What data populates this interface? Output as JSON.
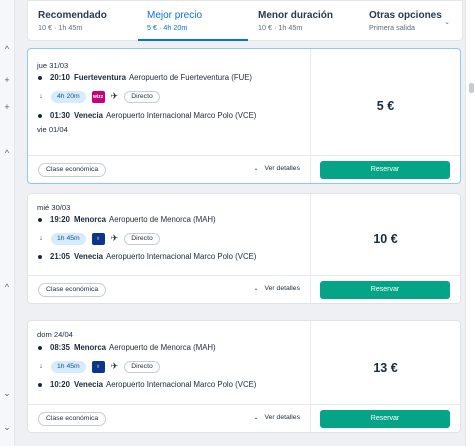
{
  "sort_tabs": [
    {
      "title": "Recomendado",
      "sub": "10 € · 1h 45m"
    },
    {
      "title": "Mejor precio",
      "sub": "5 € · 4h 20m"
    },
    {
      "title": "Menor duración",
      "sub": "10 € · 1h 45m"
    },
    {
      "title": "Otras opciones",
      "sub": "Primera salida"
    }
  ],
  "left_rail_glyphs": [
    "^",
    "+",
    "+",
    "^",
    "^",
    "⌄",
    "⌄"
  ],
  "cards": [
    {
      "date_out": "jue 31/03",
      "dep_time": "20:10",
      "dep_city": "Fuerteventura",
      "dep_airport": "Aeropuerto de Fuerteventura (FUE)",
      "duration": "4h 20m",
      "airline": "wizz",
      "stops": "Directo",
      "arr_time": "01:30",
      "arr_city": "Venecia",
      "arr_airport": "Aeropuerto Internacional Marco Polo (VCE)",
      "date_arr": "vie 01/04",
      "cabin": "Clase económica",
      "details": "Ver detalles",
      "price": "5 €",
      "reserve": "Reservar"
    },
    {
      "date_out": "mié 30/03",
      "dep_time": "19:20",
      "dep_city": "Menorca",
      "dep_airport": "Aeropuerto de Menorca (MAH)",
      "duration": "1h 45m",
      "airline": "ryanair",
      "stops": "Directo",
      "arr_time": "21:05",
      "arr_city": "Venecia",
      "arr_airport": "Aeropuerto Internacional Marco Polo (VCE)",
      "cabin": "Clase económica",
      "details": "Ver detalles",
      "price": "10 €",
      "reserve": "Reservar"
    },
    {
      "date_out": "dom 24/04",
      "dep_time": "08:35",
      "dep_city": "Menorca",
      "dep_airport": "Aeropuerto de Menorca (MAH)",
      "duration": "1h 45m",
      "airline": "ryanair",
      "stops": "Directo",
      "arr_time": "10:20",
      "arr_city": "Venecia",
      "arr_airport": "Aeropuerto Internacional Marco Polo (VCE)",
      "cabin": "Clase económica",
      "details": "Ver detalles",
      "price": "13 €",
      "reserve": "Reservar"
    }
  ],
  "colors": {
    "accent": "#0770e3",
    "reserve": "#06a487",
    "wizz": "#c6007e",
    "ryanair": "#073590",
    "ryanair_harp": "#f1c933"
  }
}
